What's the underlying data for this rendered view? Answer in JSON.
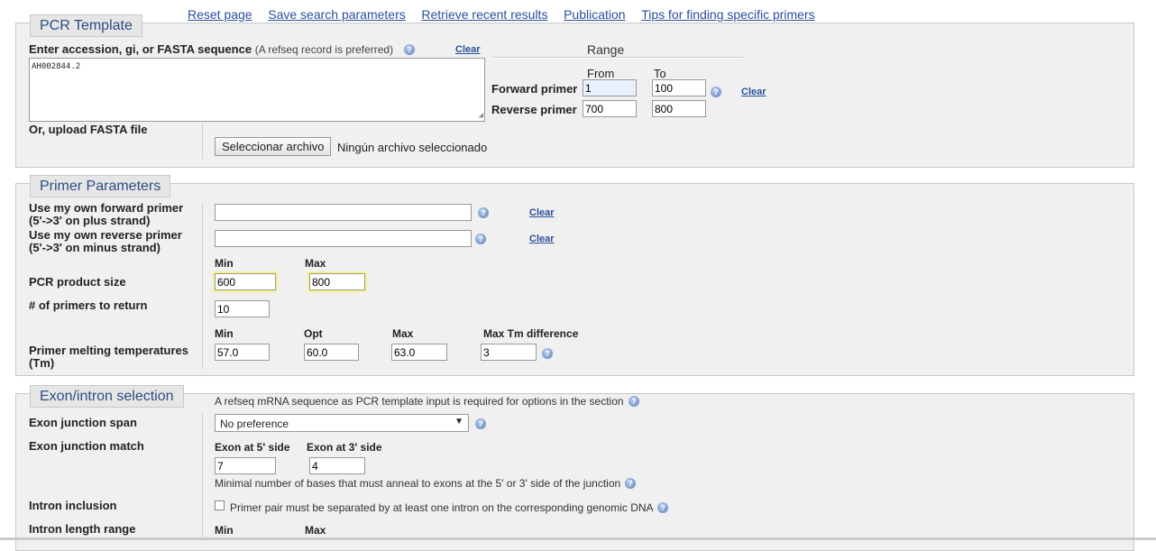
{
  "top_links": [
    "Reset page",
    "Save search parameters",
    "Retrieve recent results",
    "Publication",
    "Tips for finding specific primers"
  ],
  "pcr_template": {
    "legend": "PCR Template",
    "accession_label": "Enter accession, gi, or FASTA sequence",
    "accession_hint": "(A refseq record is preferred)",
    "clear": "Clear",
    "sequence_value": "AH002844.2",
    "upload_label": "Or, upload FASTA file",
    "file_button": "Seleccionar archivo",
    "file_status": "Ningún archivo seleccionado",
    "range": {
      "title": "Range",
      "from_label": "From",
      "to_label": "To",
      "forward_label": "Forward primer",
      "reverse_label": "Reverse primer",
      "forward_from": "1",
      "forward_to": "100",
      "reverse_from": "700",
      "reverse_to": "800",
      "clear": "Clear"
    }
  },
  "primer_parameters": {
    "legend": "Primer Parameters",
    "fwd_label_1": "Use my own forward primer",
    "fwd_label_2": "(5'->3' on plus strand)",
    "rev_label_1": "Use my own reverse primer",
    "rev_label_2": "(5'->3' on minus strand)",
    "clear": "Clear",
    "product_size_label": "PCR product size",
    "min_label": "Min",
    "max_label": "Max",
    "opt_label": "Opt",
    "product_min": "600",
    "product_max": "800",
    "num_primers_label": "# of primers to return",
    "num_primers": "10",
    "tm_label_1": "Primer melting temperatures",
    "tm_label_2": "(Tm)",
    "tm_diff_label": "Max Tm difference",
    "tm_min": "57.0",
    "tm_opt": "60.0",
    "tm_max": "63.0",
    "tm_diff": "3"
  },
  "exon_intron": {
    "legend": "Exon/intron selection",
    "note": "A refseq mRNA sequence as PCR template input is required for options in the section",
    "junction_span_label": "Exon junction span",
    "junction_span_value": "No preference",
    "junction_match_label": "Exon junction match",
    "exon5_label": "Exon at 5' side",
    "exon3_label": "Exon at 3' side",
    "exon5_value": "7",
    "exon3_value": "4",
    "match_note": "Minimal number of bases that must anneal to exons at the 5' or 3' side of the junction",
    "intron_inclusion_label": "Intron inclusion",
    "intron_checkbox_label": "Primer pair must be separated by at least one intron on the corresponding genomic DNA",
    "intron_length_label": "Intron length range",
    "min_label": "Min",
    "max_label": "Max"
  }
}
